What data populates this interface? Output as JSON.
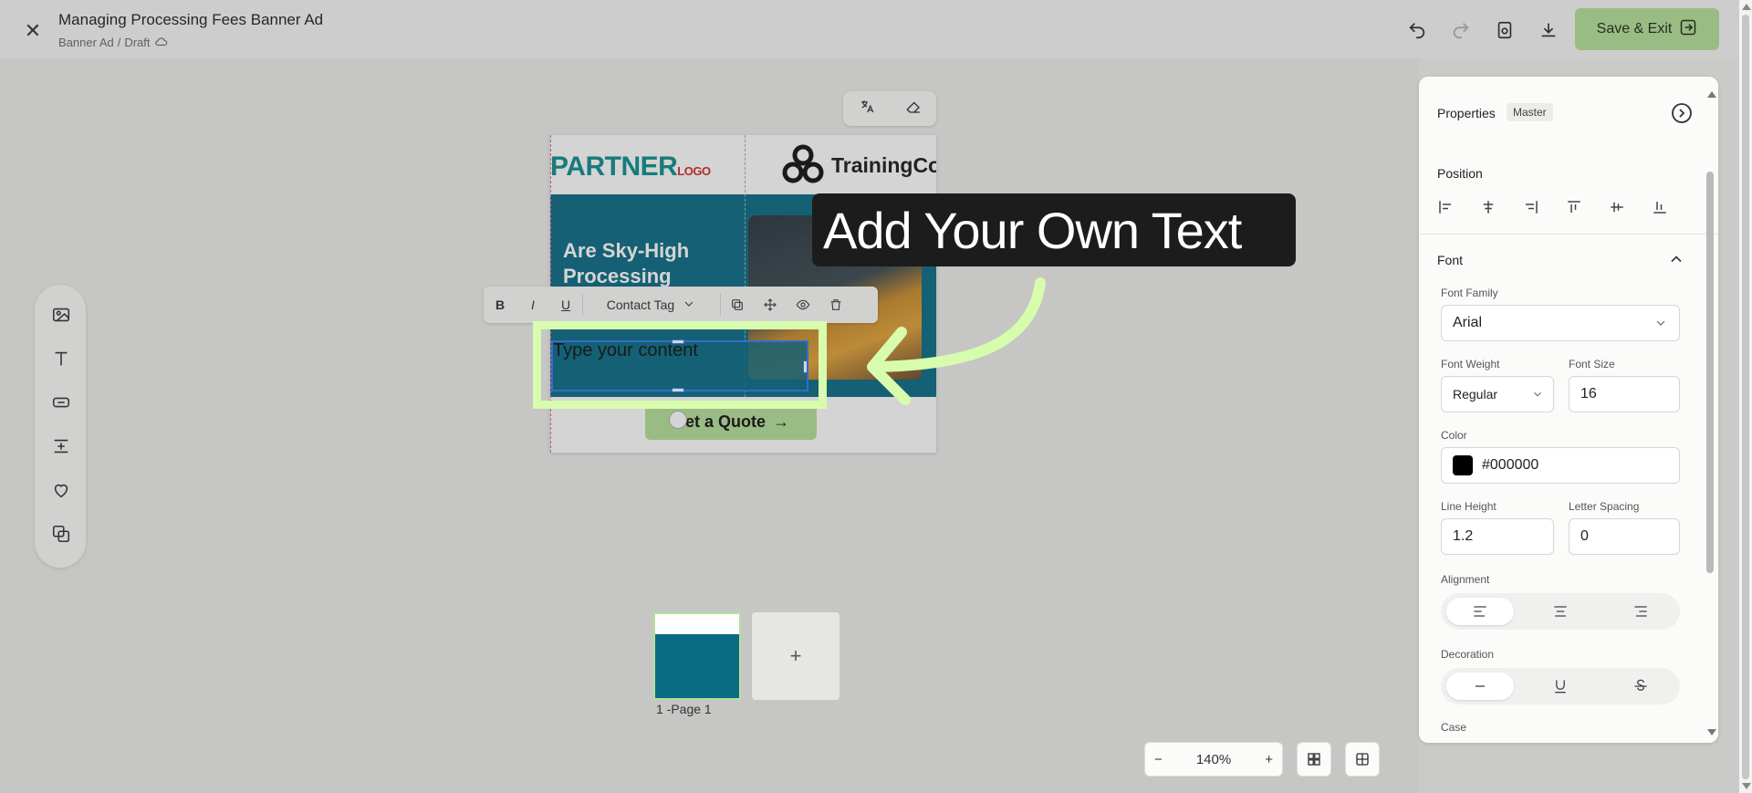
{
  "header": {
    "title": "Managing Processing Fees Banner Ad",
    "crumb_1": "Banner Ad",
    "crumb_sep": "/",
    "crumb_2": "Draft",
    "save_label": "Save & Exit"
  },
  "banner": {
    "partner_text": "PARTNER",
    "partner_small": "LOGO",
    "brand": "TrainingCo",
    "headline_1": "Are Sky-High",
    "headline_2": "Processing",
    "cta": "Get a Quote"
  },
  "text_toolbar": {
    "bold": "B",
    "italic": "I",
    "underline": "U",
    "contact_tag": "Contact Tag"
  },
  "selected_text": "Type your content",
  "callout": "Add Your Own Text",
  "pages": {
    "add": "+",
    "page_label": "1 -Page 1"
  },
  "zoom": {
    "minus": "−",
    "level": "140%",
    "plus": "+"
  },
  "properties": {
    "title": "Properties",
    "badge": "Master",
    "position_label": "Position",
    "font_label": "Font",
    "font_family_label": "Font Family",
    "font_family": "Arial",
    "font_weight_label": "Font Weight",
    "font_weight": "Regular",
    "font_size_label": "Font Size",
    "font_size": "16",
    "color_label": "Color",
    "color": "#000000",
    "line_height_label": "Line Height",
    "line_height": "1.2",
    "letter_spacing_label": "Letter Spacing",
    "letter_spacing": "0",
    "alignment_label": "Alignment",
    "decoration_label": "Decoration",
    "case_label": "Case"
  },
  "colors": {
    "accent": "#b4e09a",
    "banner_teal": "#0b6b85",
    "selection": "#2e7cf6"
  }
}
